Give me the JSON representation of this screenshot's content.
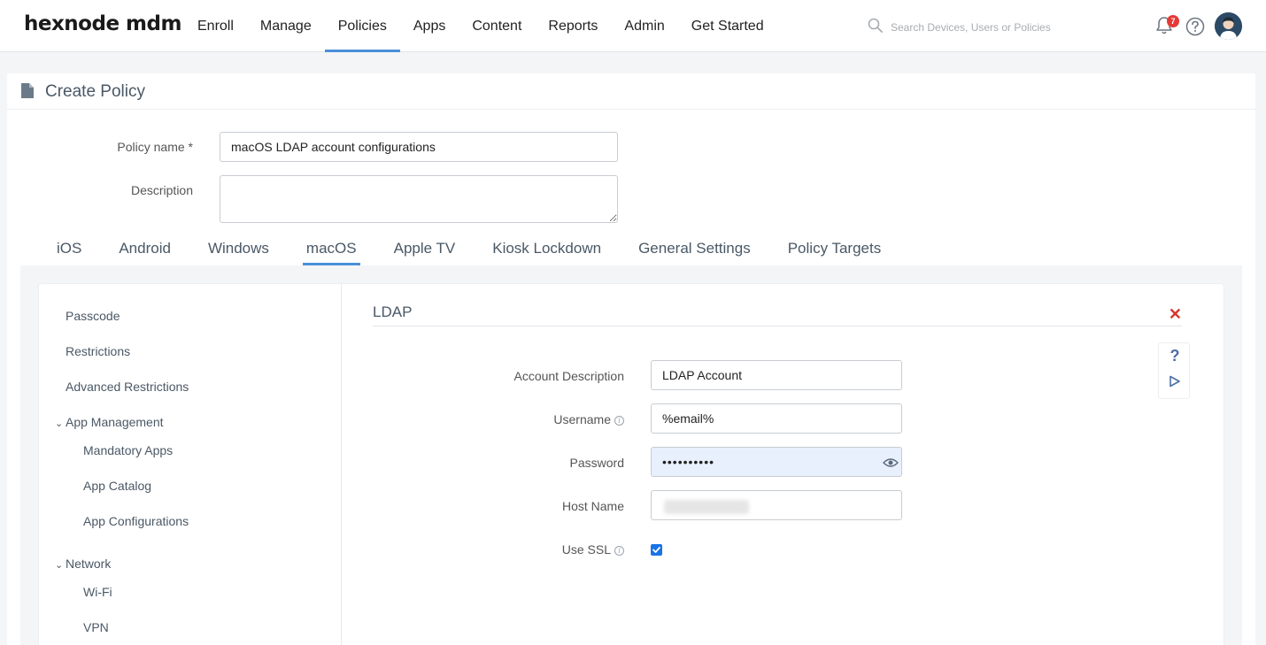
{
  "brand": {
    "logo_text": "hexnode mdm"
  },
  "nav": {
    "items": [
      "Enroll",
      "Manage",
      "Policies",
      "Apps",
      "Content",
      "Reports",
      "Admin",
      "Get Started"
    ],
    "active": "Policies"
  },
  "search": {
    "placeholder": "Search Devices, Users or Policies"
  },
  "notifications": {
    "count": "7"
  },
  "page": {
    "title": "Create Policy"
  },
  "policy_form": {
    "name_label": "Policy name *",
    "name_value": "macOS LDAP account configurations",
    "description_label": "Description",
    "description_value": ""
  },
  "os_tabs": {
    "items": [
      "iOS",
      "Android",
      "Windows",
      "macOS",
      "Apple TV",
      "Kiosk Lockdown",
      "General Settings",
      "Policy Targets"
    ],
    "active": "macOS"
  },
  "sidebar": {
    "passcode": "Passcode",
    "restrictions": "Restrictions",
    "advanced_restrictions": "Advanced Restrictions",
    "app_management": "App Management",
    "mandatory_apps": "Mandatory Apps",
    "app_catalog": "App Catalog",
    "app_configurations": "App Configurations",
    "network": "Network",
    "wifi": "Wi-Fi",
    "vpn": "VPN"
  },
  "ldap": {
    "title": "LDAP",
    "account_description_label": "Account Description",
    "account_description_value": "LDAP Account",
    "username_label": "Username",
    "username_value": "%email%",
    "password_label": "Password",
    "password_value": "••••••••••",
    "host_name_label": "Host Name",
    "use_ssl_label": "Use SSL",
    "use_ssl_checked": true
  },
  "help": {
    "question_mark": "?"
  },
  "colors": {
    "accent": "#4a90d9",
    "badge": "#e53935",
    "close": "#d9342b",
    "checkbox": "#1a73e8"
  }
}
